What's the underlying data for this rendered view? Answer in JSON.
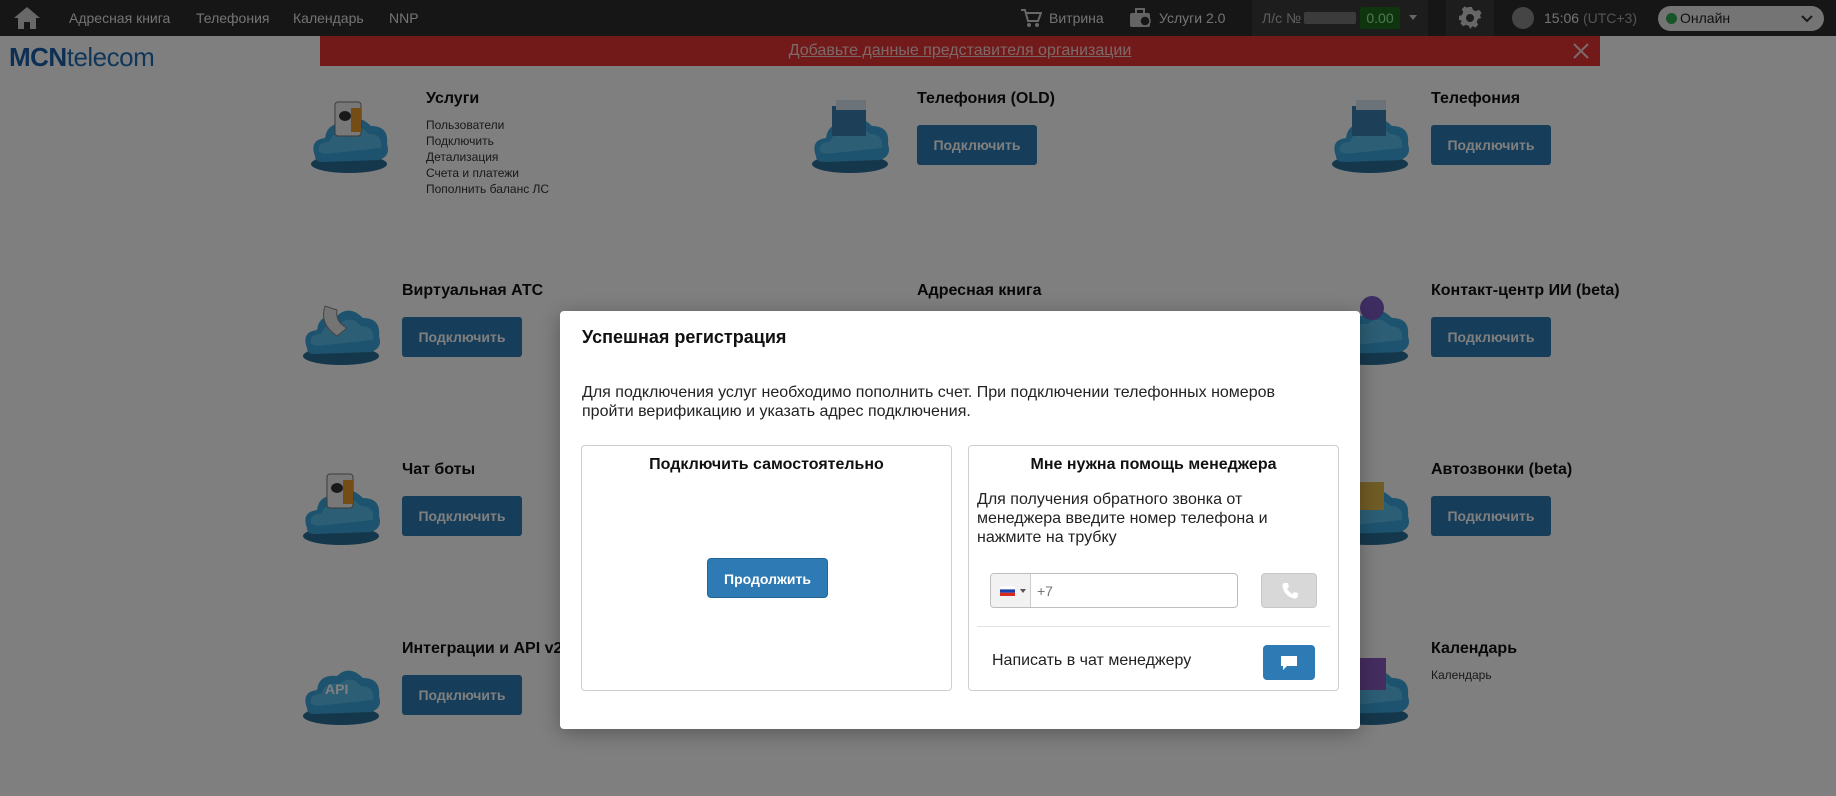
{
  "topbar": {
    "nav": [
      "Адресная книга",
      "Телефония",
      "Календарь",
      "NNP"
    ],
    "showcase_label": "Витрина",
    "services2_label": "Услуги 2.0",
    "account_label": "Л/с №",
    "balance_value": "0.00",
    "time": "15:06",
    "timezone": "(UTC+3)",
    "status_label": "Онлайн",
    "colors": {
      "bar": "#2c2c2c",
      "balance": "#1d6b1d",
      "online": "#2fa84f"
    }
  },
  "logo": {
    "bold": "MCN",
    "rest": "telecom"
  },
  "banner": {
    "text": "Добавьте данные представителя организации",
    "color": "#e53535"
  },
  "services": {
    "uslugi": {
      "title": "Услуги",
      "links": [
        "Пользователи",
        "Подключить",
        "Детализация",
        "Счета и платежи",
        "Пополнить баланс ЛС"
      ]
    },
    "telephony_old": {
      "title": "Телефония (OLD)",
      "button": "Подключить"
    },
    "telephony": {
      "title": "Телефония",
      "button": "Подключить"
    },
    "vats": {
      "title": "Виртуальная АТС",
      "button": "Подключить"
    },
    "address_book": {
      "title": "Адресная книга"
    },
    "contact_center": {
      "title": "Контакт-центр ИИ (beta)",
      "button": "Подключить"
    },
    "chatbots": {
      "title": "Чат боты",
      "button": "Подключить"
    },
    "autocalls": {
      "title": "Автозвонки (beta)",
      "button": "Подключить"
    },
    "integrations": {
      "title": "Интеграции и API v2.",
      "button": "Подключить"
    },
    "calendar": {
      "title": "Календарь",
      "links": [
        "Календарь"
      ]
    }
  },
  "modal": {
    "title": "Успешная регистрация",
    "description": "Для подключения услуг необходимо пополнить счет. При подключении телефонных номеров пройти верификацию и указать адрес подключения.",
    "self": {
      "title": "Подключить самостоятельно",
      "button": "Продолжить"
    },
    "manager": {
      "title": "Мне нужна помощь менеджера",
      "text": "Для получения обратного звонка от менеджера введите номер телефона и нажмите на трубку",
      "phone_placeholder": "+7",
      "chat_label": "Написать в чат менеджеру"
    },
    "accent": "#2d7ab4"
  }
}
